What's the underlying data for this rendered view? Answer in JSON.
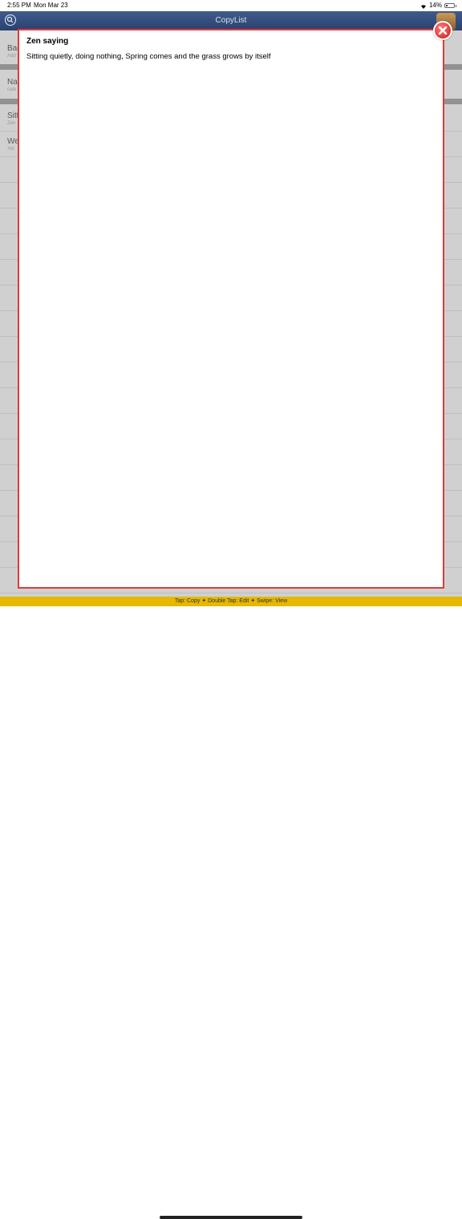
{
  "status_bar": {
    "time": "2:55 PM",
    "date": "Mon Mar 23",
    "battery": "14%",
    "battery_level": 0.14
  },
  "nav": {
    "title": "CopyList"
  },
  "list": {
    "rows": [
      {
        "title": "Bac",
        "sub": "Add"
      },
      {
        "title": "Nai",
        "sub": "cate"
      },
      {
        "title": "Sitt",
        "sub": "Zen"
      },
      {
        "title": "We",
        "sub": "Yet"
      }
    ]
  },
  "popup": {
    "title": "Zen saying",
    "body": "Sitting quietly, doing nothing, Spring comes and the grass grows by itself"
  },
  "bottom_bar": {
    "hint": "Tap: Copy ✦ Double Tap: Edit ✦ Swipe: View"
  },
  "colors": {
    "nav": "#2f4778",
    "popup_border": "#e53935",
    "hint_bar": "#e6b800"
  }
}
